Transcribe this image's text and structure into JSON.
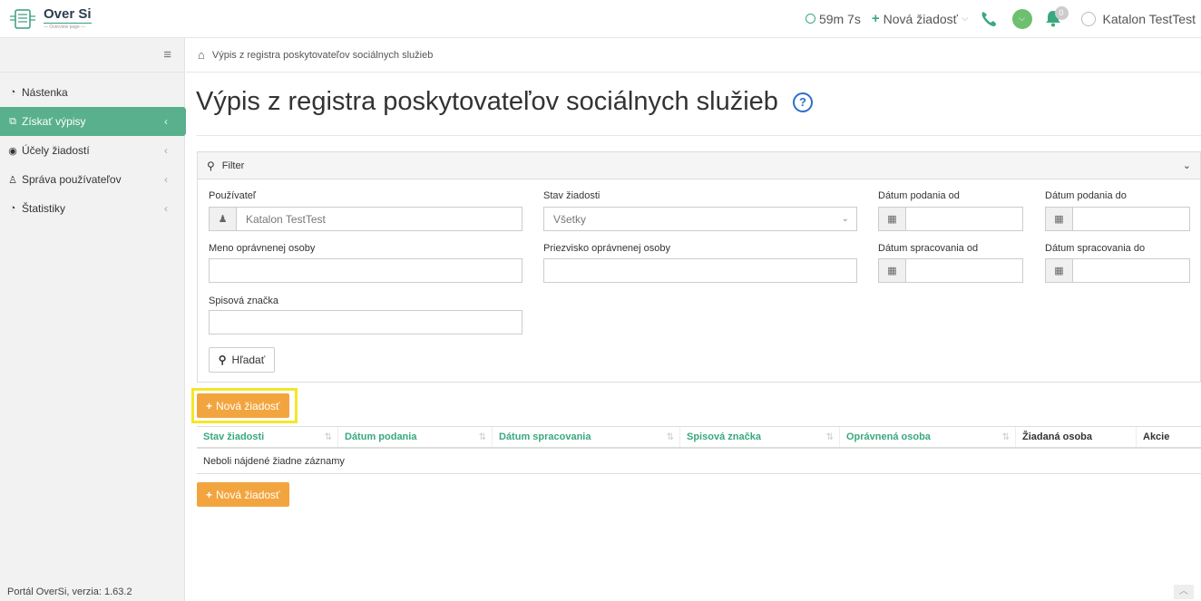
{
  "header": {
    "logo_title": "Over Si",
    "logo_sub": "— Overview page —",
    "timer": "59m 7s",
    "new_request": "Nová žiadosť",
    "notification_count": "0",
    "user_name": "Katalon TestTest",
    "colors": {
      "accent": "#3aa87e",
      "green_dot": "#6cc06f"
    }
  },
  "sidebar": {
    "items": [
      {
        "label": "Nástenka",
        "icon": "dashboard-icon"
      },
      {
        "label": "Získať výpisy",
        "icon": "copy-icon",
        "active": true
      },
      {
        "label": "Účely žiadostí",
        "icon": "target-icon"
      },
      {
        "label": "Správa používateľov",
        "icon": "users-icon"
      },
      {
        "label": "Štatistiky",
        "icon": "dashboard-icon"
      }
    ],
    "footer": "Portál OverSi, verzia: 1.63.2",
    "colors": {
      "active_bg": "#58b08d"
    }
  },
  "breadcrumb": {
    "current": "Výpis z registra poskytovateľov sociálnych služieb"
  },
  "page": {
    "title": "Výpis z registra poskytovateľov sociálnych služieb",
    "help": "?"
  },
  "filter": {
    "title": "Filter",
    "user_label": "Používateľ",
    "user_value": "Katalon TestTest",
    "status_label": "Stav žiadosti",
    "status_value": "Všetky",
    "submitted_from_label": "Dátum podania od",
    "submitted_to_label": "Dátum podania do",
    "first_name_label": "Meno oprávnenej osoby",
    "last_name_label": "Priezvisko oprávnenej osoby",
    "processed_from_label": "Dátum spracovania od",
    "processed_to_label": "Dátum spracovania do",
    "file_number_label": "Spisová značka",
    "search_button": "Hľadať"
  },
  "actions": {
    "new_request_button": "Nová žiadosť",
    "button_color": "#f2a53f",
    "highlight_color": "#f4e62a"
  },
  "table": {
    "columns": [
      {
        "label": "Stav žiadosti",
        "sortable": true
      },
      {
        "label": "Dátum podania",
        "sortable": true
      },
      {
        "label": "Dátum spracovania",
        "sortable": true
      },
      {
        "label": "Spisová značka",
        "sortable": true
      },
      {
        "label": "Oprávnená osoba",
        "sortable": true
      },
      {
        "label": "Žiadaná osoba",
        "sortable": false
      },
      {
        "label": "Akcie",
        "sortable": false
      }
    ],
    "empty_message": "Neboli nájdené žiadne záznamy"
  }
}
